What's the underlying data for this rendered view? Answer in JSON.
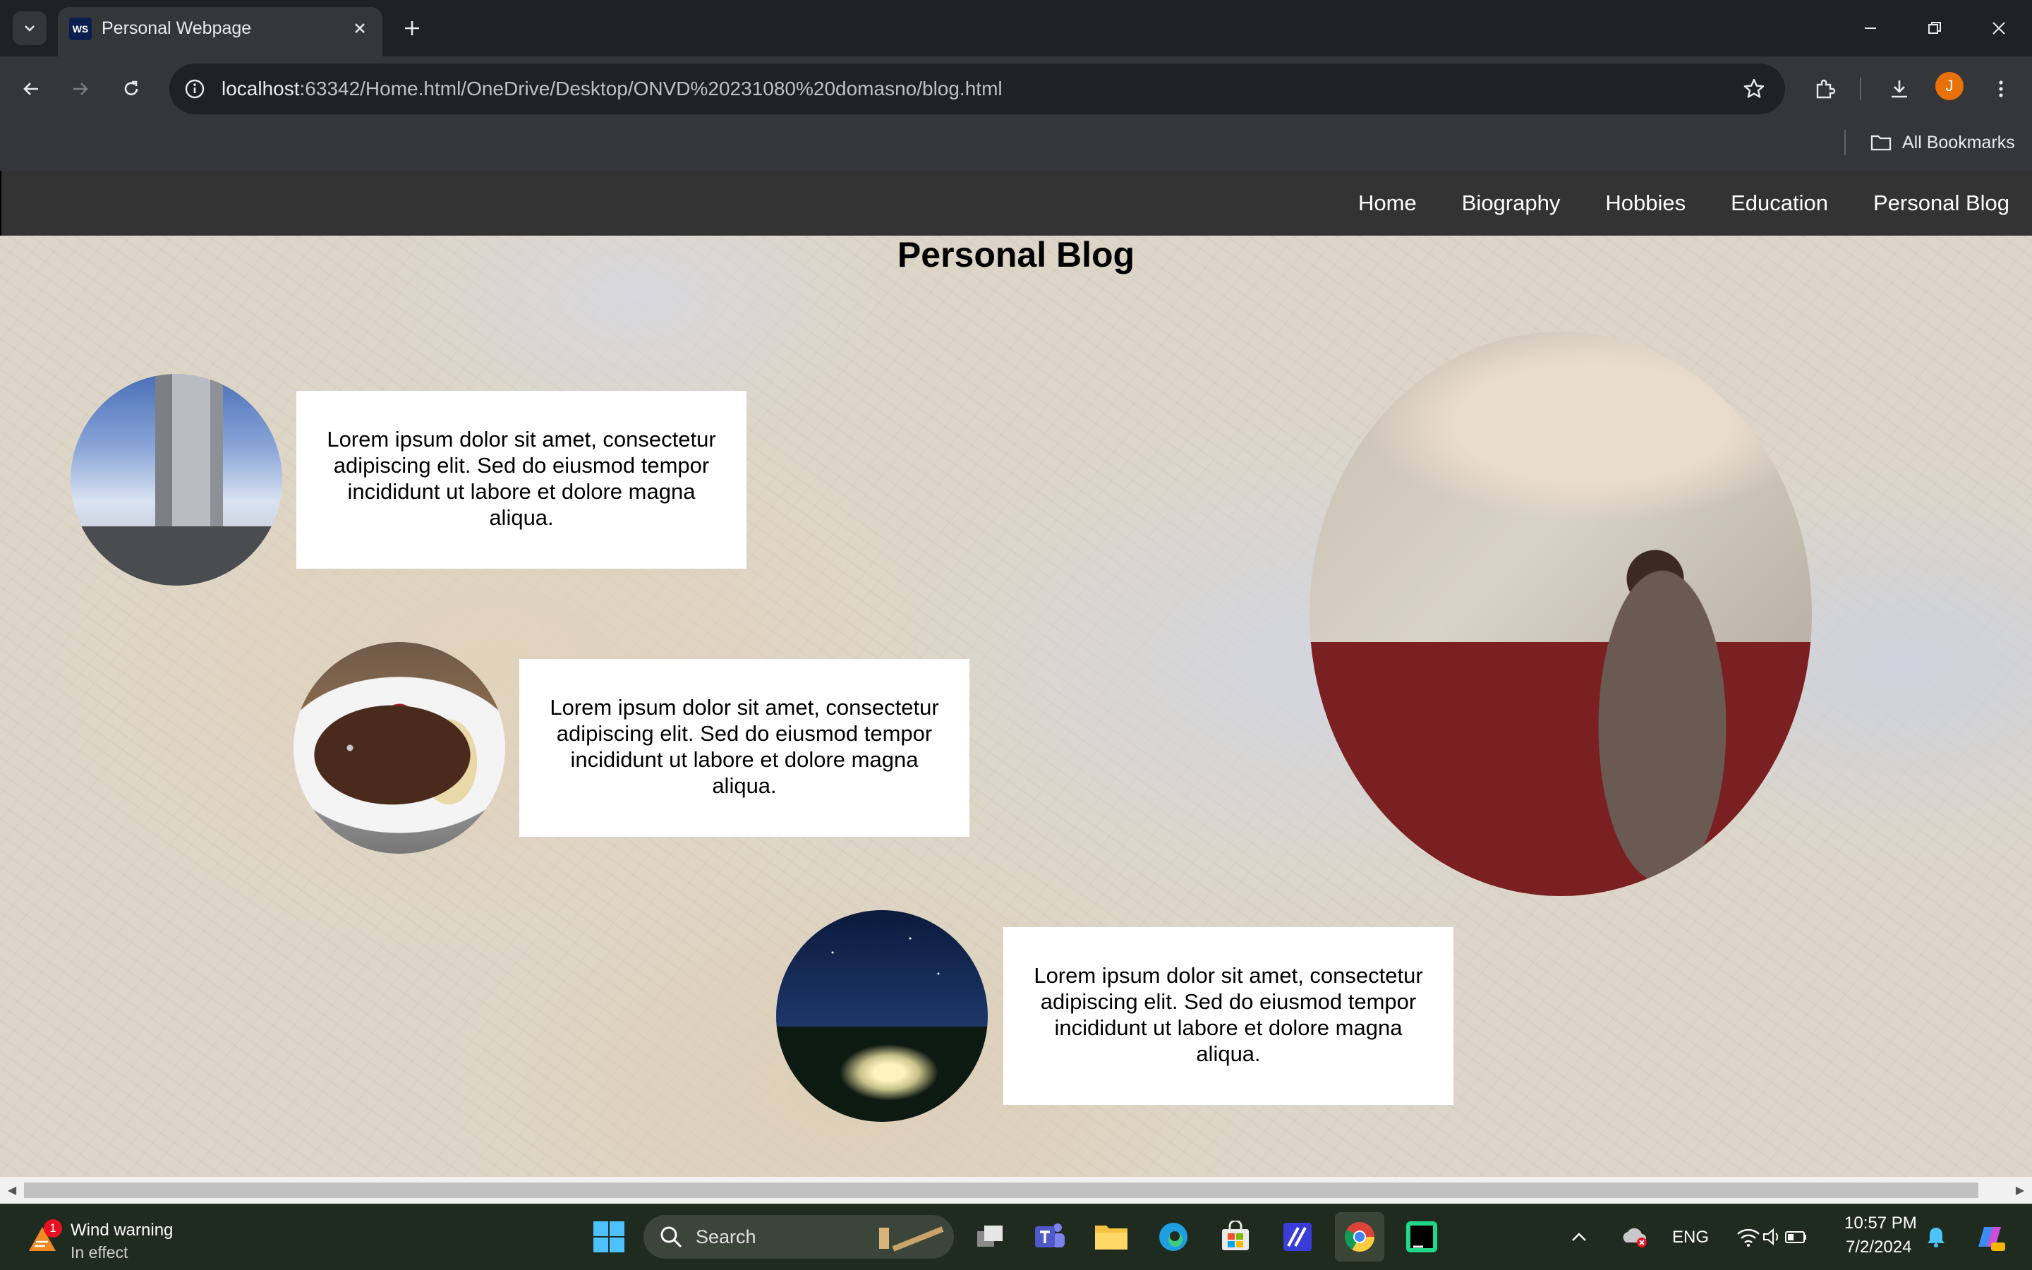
{
  "browser": {
    "tab_title": "Personal Webpage",
    "tab_favicon_text": "WS",
    "url_host": "localhost",
    "url_rest": ":63342/Home.html/OneDrive/Desktop/ONVD%20231080%20domasno/blog.html",
    "profile_initial": "J",
    "bookmarks_label": "All Bookmarks"
  },
  "site": {
    "nav": [
      "Home",
      "Biography",
      "Hobbies",
      "Education",
      "Personal Blog"
    ],
    "title": "Personal Blog",
    "posts": [
      {
        "text": "Lorem ipsum dolor sit amet, consectetur adipiscing elit. Sed do eiusmod tempor incididunt ut labore et dolore magna aliqua."
      },
      {
        "text": "Lorem ipsum dolor sit amet, consectetur adipiscing elit. Sed do eiusmod tempor incididunt ut labore et dolore magna aliqua."
      },
      {
        "text": "Lorem ipsum dolor sit amet, consectetur adipiscing elit. Sed do eiusmod tempor incididunt ut labore et dolore magna aliqua."
      }
    ]
  },
  "taskbar": {
    "weather_title": "Wind warning",
    "weather_sub": "In effect",
    "weather_badge": "1",
    "search_label": "Search",
    "language": "ENG",
    "time": "10:57 PM",
    "date": "7/2/2024"
  },
  "colors": {
    "nav_bg": "#333333",
    "chrome_dark": "#202124",
    "chrome_toolbar": "#35363a",
    "profile_accent": "#e8710a"
  }
}
